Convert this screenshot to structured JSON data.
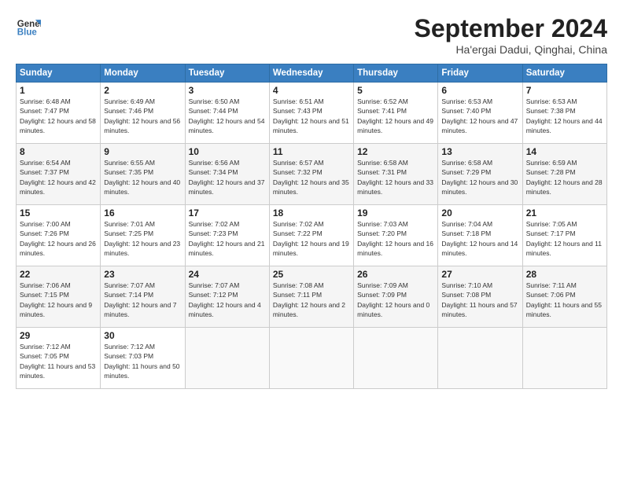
{
  "header": {
    "logo_line1": "General",
    "logo_line2": "Blue",
    "title": "September 2024",
    "location": "Ha'ergai Dadui, Qinghai, China"
  },
  "weekdays": [
    "Sunday",
    "Monday",
    "Tuesday",
    "Wednesday",
    "Thursday",
    "Friday",
    "Saturday"
  ],
  "weeks": [
    [
      {
        "day": "1",
        "sunrise": "6:48 AM",
        "sunset": "7:47 PM",
        "daylight": "12 hours and 58 minutes."
      },
      {
        "day": "2",
        "sunrise": "6:49 AM",
        "sunset": "7:46 PM",
        "daylight": "12 hours and 56 minutes."
      },
      {
        "day": "3",
        "sunrise": "6:50 AM",
        "sunset": "7:44 PM",
        "daylight": "12 hours and 54 minutes."
      },
      {
        "day": "4",
        "sunrise": "6:51 AM",
        "sunset": "7:43 PM",
        "daylight": "12 hours and 51 minutes."
      },
      {
        "day": "5",
        "sunrise": "6:52 AM",
        "sunset": "7:41 PM",
        "daylight": "12 hours and 49 minutes."
      },
      {
        "day": "6",
        "sunrise": "6:53 AM",
        "sunset": "7:40 PM",
        "daylight": "12 hours and 47 minutes."
      },
      {
        "day": "7",
        "sunrise": "6:53 AM",
        "sunset": "7:38 PM",
        "daylight": "12 hours and 44 minutes."
      }
    ],
    [
      {
        "day": "8",
        "sunrise": "6:54 AM",
        "sunset": "7:37 PM",
        "daylight": "12 hours and 42 minutes."
      },
      {
        "day": "9",
        "sunrise": "6:55 AM",
        "sunset": "7:35 PM",
        "daylight": "12 hours and 40 minutes."
      },
      {
        "day": "10",
        "sunrise": "6:56 AM",
        "sunset": "7:34 PM",
        "daylight": "12 hours and 37 minutes."
      },
      {
        "day": "11",
        "sunrise": "6:57 AM",
        "sunset": "7:32 PM",
        "daylight": "12 hours and 35 minutes."
      },
      {
        "day": "12",
        "sunrise": "6:58 AM",
        "sunset": "7:31 PM",
        "daylight": "12 hours and 33 minutes."
      },
      {
        "day": "13",
        "sunrise": "6:58 AM",
        "sunset": "7:29 PM",
        "daylight": "12 hours and 30 minutes."
      },
      {
        "day": "14",
        "sunrise": "6:59 AM",
        "sunset": "7:28 PM",
        "daylight": "12 hours and 28 minutes."
      }
    ],
    [
      {
        "day": "15",
        "sunrise": "7:00 AM",
        "sunset": "7:26 PM",
        "daylight": "12 hours and 26 minutes."
      },
      {
        "day": "16",
        "sunrise": "7:01 AM",
        "sunset": "7:25 PM",
        "daylight": "12 hours and 23 minutes."
      },
      {
        "day": "17",
        "sunrise": "7:02 AM",
        "sunset": "7:23 PM",
        "daylight": "12 hours and 21 minutes."
      },
      {
        "day": "18",
        "sunrise": "7:02 AM",
        "sunset": "7:22 PM",
        "daylight": "12 hours and 19 minutes."
      },
      {
        "day": "19",
        "sunrise": "7:03 AM",
        "sunset": "7:20 PM",
        "daylight": "12 hours and 16 minutes."
      },
      {
        "day": "20",
        "sunrise": "7:04 AM",
        "sunset": "7:18 PM",
        "daylight": "12 hours and 14 minutes."
      },
      {
        "day": "21",
        "sunrise": "7:05 AM",
        "sunset": "7:17 PM",
        "daylight": "12 hours and 11 minutes."
      }
    ],
    [
      {
        "day": "22",
        "sunrise": "7:06 AM",
        "sunset": "7:15 PM",
        "daylight": "12 hours and 9 minutes."
      },
      {
        "day": "23",
        "sunrise": "7:07 AM",
        "sunset": "7:14 PM",
        "daylight": "12 hours and 7 minutes."
      },
      {
        "day": "24",
        "sunrise": "7:07 AM",
        "sunset": "7:12 PM",
        "daylight": "12 hours and 4 minutes."
      },
      {
        "day": "25",
        "sunrise": "7:08 AM",
        "sunset": "7:11 PM",
        "daylight": "12 hours and 2 minutes."
      },
      {
        "day": "26",
        "sunrise": "7:09 AM",
        "sunset": "7:09 PM",
        "daylight": "12 hours and 0 minutes."
      },
      {
        "day": "27",
        "sunrise": "7:10 AM",
        "sunset": "7:08 PM",
        "daylight": "11 hours and 57 minutes."
      },
      {
        "day": "28",
        "sunrise": "7:11 AM",
        "sunset": "7:06 PM",
        "daylight": "11 hours and 55 minutes."
      }
    ],
    [
      {
        "day": "29",
        "sunrise": "7:12 AM",
        "sunset": "7:05 PM",
        "daylight": "11 hours and 53 minutes."
      },
      {
        "day": "30",
        "sunrise": "7:12 AM",
        "sunset": "7:03 PM",
        "daylight": "11 hours and 50 minutes."
      },
      null,
      null,
      null,
      null,
      null
    ]
  ]
}
